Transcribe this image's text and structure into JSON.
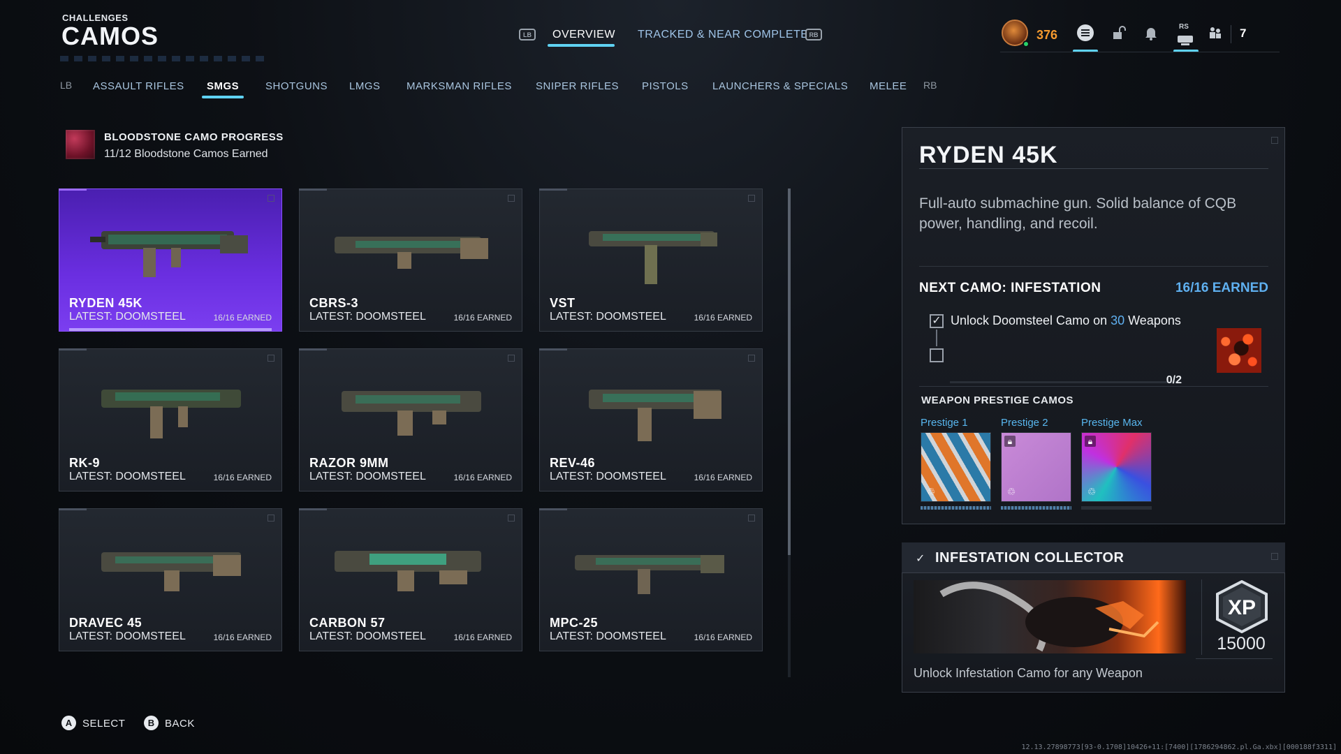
{
  "header": {
    "subtitle": "CHALLENGES",
    "title": "CAMOS",
    "tabs": [
      {
        "label": "OVERVIEW",
        "active": true
      },
      {
        "label": "TRACKED & NEAR COMPLETE",
        "active": false
      }
    ],
    "left_bumper": "LB",
    "right_bumper": "RB"
  },
  "topright": {
    "currency": "376",
    "notif_count": "7",
    "rs_label": "RS",
    "icons": [
      "rank-emblem",
      "menu-icon",
      "unlock-icon",
      "bell-icon",
      "profile-icon",
      "party-icon"
    ]
  },
  "categories": {
    "left_bumper": "LB",
    "right_bumper": "RB",
    "items": [
      {
        "label": "ASSAULT RIFLES"
      },
      {
        "label": "SMGS"
      },
      {
        "label": "SHOTGUNS"
      },
      {
        "label": "LMGS"
      },
      {
        "label": "MARKSMAN RIFLES"
      },
      {
        "label": "SNIPER RIFLES"
      },
      {
        "label": "PISTOLS"
      },
      {
        "label": "LAUNCHERS & SPECIALS"
      },
      {
        "label": "MELEE"
      }
    ],
    "active_index": 1
  },
  "progress": {
    "title": "BLOODSTONE CAMO PROGRESS",
    "subtitle": "11/12 Bloodstone Camos Earned"
  },
  "weapons": [
    {
      "name": "RYDEN 45K",
      "latest": "LATEST: DOOMSTEEL",
      "earned": "16/16 EARNED"
    },
    {
      "name": "CBRS-3",
      "latest": "LATEST: DOOMSTEEL",
      "earned": "16/16 EARNED"
    },
    {
      "name": "VST",
      "latest": "LATEST: DOOMSTEEL",
      "earned": "16/16 EARNED"
    },
    {
      "name": "RK-9",
      "latest": "LATEST: DOOMSTEEL",
      "earned": "16/16 EARNED"
    },
    {
      "name": "RAZOR 9MM",
      "latest": "LATEST: DOOMSTEEL",
      "earned": "16/16 EARNED"
    },
    {
      "name": "REV-46",
      "latest": "LATEST: DOOMSTEEL",
      "earned": "16/16 EARNED"
    },
    {
      "name": "DRAVEC 45",
      "latest": "LATEST: DOOMSTEEL",
      "earned": "16/16 EARNED"
    },
    {
      "name": "CARBON 57",
      "latest": "LATEST: DOOMSTEEL",
      "earned": "16/16 EARNED"
    },
    {
      "name": "MPC-25",
      "latest": "LATEST: DOOMSTEEL",
      "earned": "16/16 EARNED"
    }
  ],
  "detail": {
    "name": "RYDEN 45K",
    "description": "Full-auto submachine gun. Solid balance of CQB power, handling, and recoil.",
    "next_camo_label": "NEXT CAMO: INFESTATION",
    "next_camo_earned": "16/16 EARNED",
    "task_prefix": "Unlock Doomsteel Camo on ",
    "task_number": "30",
    "task_suffix": " Weapons",
    "task_progress": "0/2",
    "prestige_heading": "WEAPON PRESTIGE CAMOS",
    "prestige": [
      {
        "label": "Prestige 1"
      },
      {
        "label": "Prestige 2"
      },
      {
        "label": "Prestige Max"
      }
    ]
  },
  "collector": {
    "title": "INFESTATION COLLECTOR",
    "xp_label": "XP",
    "xp_amount": "15000",
    "description": "Unlock Infestation Camo for any Weapon"
  },
  "footer": {
    "select_glyph": "A",
    "select_label": "SELECT",
    "back_glyph": "B",
    "back_label": "BACK",
    "build": "12.13.27898773[93-0.1708]10426+11:[7400][1786294862.pl.Ga.xbx][000188f3311]"
  },
  "colors": {
    "accent": "#5fd2f2",
    "selected_card": "#6a2ee0",
    "currency": "#f59a2e",
    "earned_blue": "#5fb0f0"
  }
}
